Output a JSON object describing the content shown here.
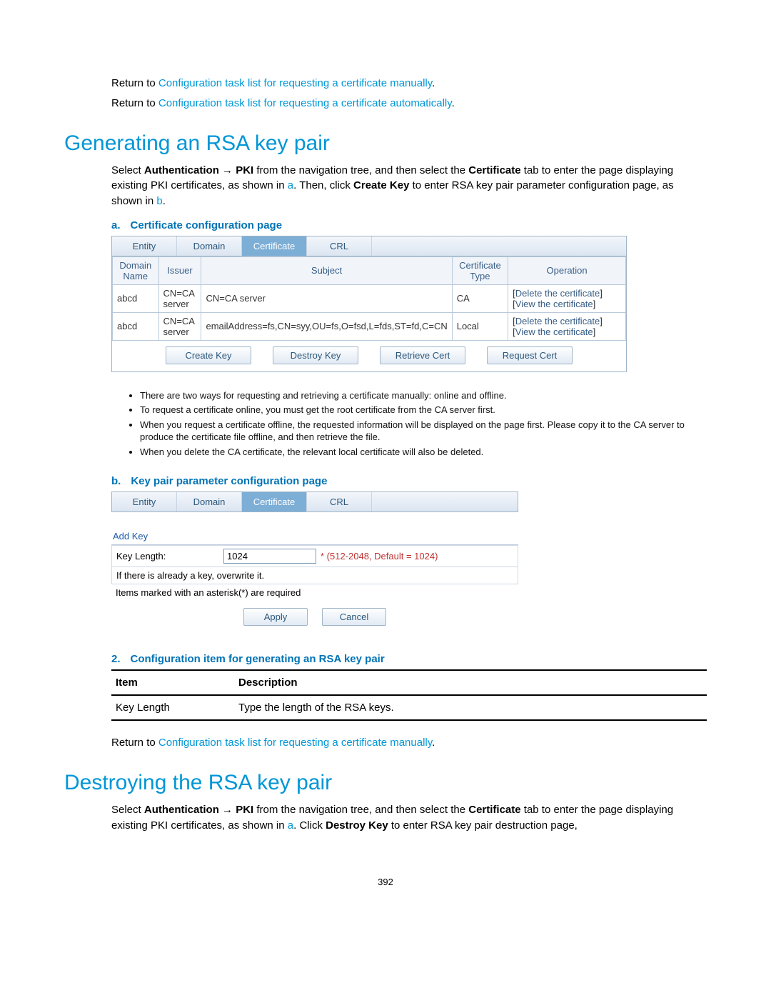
{
  "return_links": {
    "prefix": "Return to ",
    "manual": "Configuration task list for requesting a certificate manually",
    "auto": "Configuration task list for requesting a certificate automatically"
  },
  "section1": {
    "title": "Generating an RSA key pair",
    "p1a": "Select ",
    "p1b": "Authentication",
    "p1arrow": " → ",
    "p1c": "PKI",
    "p1d": " from the navigation tree, and then select the ",
    "p1e": "Certificate",
    "p1f": " tab to enter the page displaying existing PKI certificates, as shown in ",
    "p1g": "a",
    "p1h": ". Then, click ",
    "p1i": "Create Key",
    "p1j": " to enter RSA key pair parameter configuration page, as shown in ",
    "p1k": "b",
    "p1l": "."
  },
  "fig_a_caption_label": "a.",
  "fig_a_caption_text": "Certificate configuration page",
  "tabs": {
    "entity": "Entity",
    "domain": "Domain",
    "certificate": "Certificate",
    "crl": "CRL"
  },
  "cert_table": {
    "headers": {
      "domain_name": "Domain Name",
      "issuer": "Issuer",
      "subject": "Subject",
      "cert_type": "Certificate Type",
      "operation": "Operation"
    },
    "rows": [
      {
        "domain_name": "abcd",
        "issuer": "CN=CA server",
        "subject": "CN=CA server",
        "cert_type": "CA"
      },
      {
        "domain_name": "abcd",
        "issuer": "CN=CA server",
        "subject": "emailAddress=fs,CN=syy,OU=fs,O=fsd,L=fds,ST=fd,C=CN",
        "cert_type": "Local"
      }
    ],
    "op_delete": "Delete the certificate",
    "op_view": "View the certificate"
  },
  "cert_buttons": {
    "create": "Create Key",
    "destroy": "Destroy Key",
    "retrieve": "Retrieve Cert",
    "request": "Request Cert"
  },
  "notes": [
    "There are two ways for requesting and retrieving a certificate manually: online and offline.",
    "To request a certificate online, you must get the root certificate from the CA server first.",
    "When you request a certificate offline, the requested information will be displayed on the page first. Please copy it to the CA server to produce the certificate file offline, and then retrieve the file.",
    "When you delete the CA certificate, the relevant local certificate will also be deleted."
  ],
  "fig_b_caption_label": "b.",
  "fig_b_caption_text": "Key pair parameter configuration page",
  "keypanel": {
    "add_key": "Add Key",
    "key_length_label": "Key Length:",
    "key_length_value": "1024",
    "hint": "* (512-2048, Default = 1024)",
    "overwrite": "If there is already a key, overwrite it.",
    "asterisk_note": "Items marked with an asterisk(*) are required",
    "apply": "Apply",
    "cancel": "Cancel"
  },
  "fig2_label": "2.",
  "fig2_text": "Configuration item for generating an RSA key pair",
  "itemtable": {
    "h_item": "Item",
    "h_desc": "Description",
    "row_item": "Key Length",
    "row_desc": "Type the length of the RSA keys."
  },
  "section2": {
    "title": "Destroying the RSA key pair",
    "p1a": "Select ",
    "p1b": "Authentication",
    "p1arrow": " → ",
    "p1c": "PKI",
    "p1d": " from the navigation tree, and then select the ",
    "p1e": "Certificate",
    "p1f": " tab to enter the page displaying existing PKI certificates, as shown in ",
    "p1g": "a",
    "p1h": ". Click ",
    "p1i": "Destroy Key",
    "p1j": " to enter RSA key pair destruction page,"
  },
  "page_number": "392"
}
